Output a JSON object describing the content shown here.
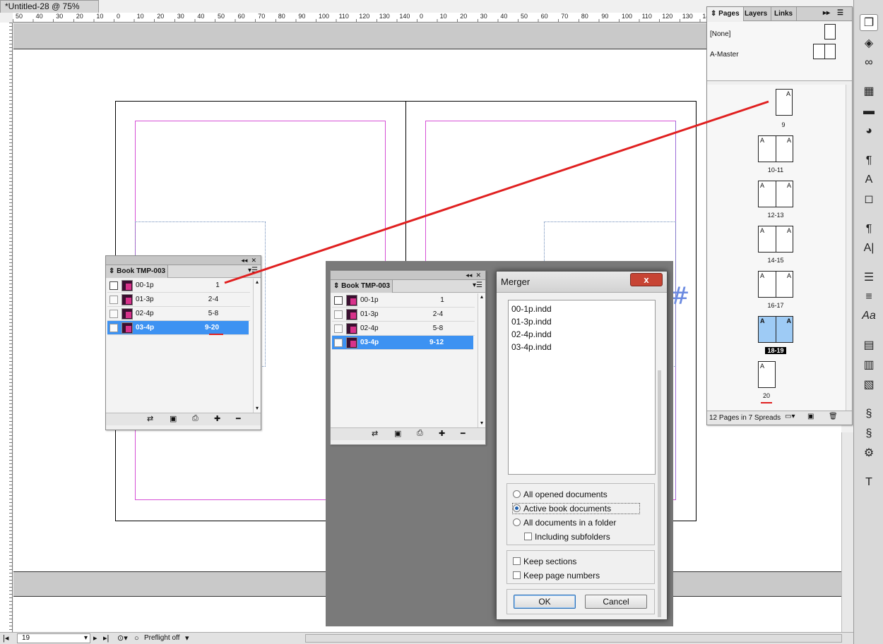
{
  "document": {
    "tab_title": "*Untitled-28 @ 75%",
    "ruler_numbers": [
      "50",
      "40",
      "30",
      "20",
      "10",
      "0",
      "10",
      "20",
      "30",
      "40",
      "50",
      "60",
      "70",
      "80",
      "90",
      "100",
      "110",
      "120",
      "130",
      "140",
      "0",
      "10",
      "20",
      "30",
      "40",
      "50",
      "60",
      "70",
      "80",
      "90",
      "100",
      "110",
      "120",
      "130",
      "140"
    ]
  },
  "book_panel_1": {
    "tab_label": "Book TMP-003",
    "rows": [
      {
        "name": "00-1p",
        "pages": "1"
      },
      {
        "name": "01-3p",
        "pages": "2-4"
      },
      {
        "name": "02-4p",
        "pages": "5-8"
      },
      {
        "name": "03-4p",
        "pages": "9-20"
      }
    ]
  },
  "book_panel_2": {
    "tab_label": "Book TMP-003",
    "rows": [
      {
        "name": "00-1p",
        "pages": "1"
      },
      {
        "name": "01-3p",
        "pages": "2-4"
      },
      {
        "name": "02-4p",
        "pages": "5-8"
      },
      {
        "name": "03-4p",
        "pages": "9-12"
      }
    ]
  },
  "merger_dialog": {
    "title": "Merger",
    "close_label": "x",
    "files": [
      "00-1p.indd",
      "01-3p.indd",
      "02-4p.indd",
      "03-4p.indd"
    ],
    "source_options": {
      "all_opened": "All opened documents",
      "active_book": "Active book documents",
      "all_in_folder": "All documents in a folder",
      "including_subfolders": "Including subfolders",
      "selected": "active_book"
    },
    "keep_sections": "Keep sections",
    "keep_page_numbers": "Keep page numbers",
    "ok_label": "OK",
    "cancel_label": "Cancel"
  },
  "pages_panel": {
    "tabs": [
      "Pages",
      "Layers",
      "Links"
    ],
    "masters": [
      "[None]",
      "A-Master"
    ],
    "spreads": [
      {
        "label": "9",
        "type": "single-right"
      },
      {
        "label": "10-11",
        "type": "spread"
      },
      {
        "label": "12-13",
        "type": "spread"
      },
      {
        "label": "14-15",
        "type": "spread"
      },
      {
        "label": "16-17",
        "type": "spread"
      },
      {
        "label": "18-19",
        "type": "spread",
        "selected": true
      },
      {
        "label": "20",
        "type": "single-left"
      }
    ],
    "master_letter": "A",
    "footer_text": "12 Pages in 7 Spreads"
  },
  "status_bar": {
    "page_number": "19",
    "preflight": "Preflight off"
  },
  "glyph_hash": "#",
  "colors": {
    "selection": "#3d92f2",
    "annotation_red": "#e02020",
    "margin_guide": "#d54fd5",
    "page_selected": "#9ecbf5"
  }
}
